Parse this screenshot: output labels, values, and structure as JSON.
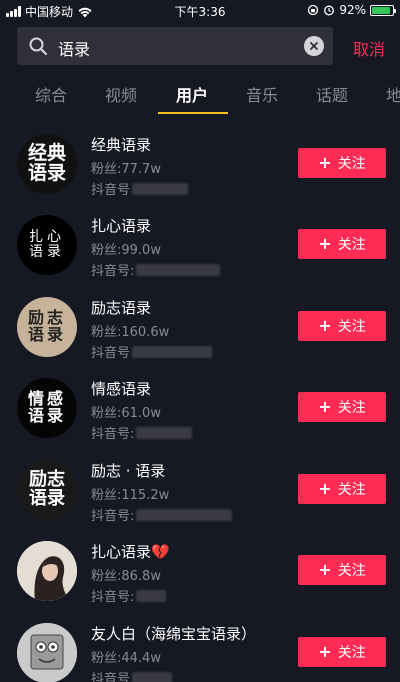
{
  "status_bar": {
    "carrier": "中国移动",
    "time": "下午3:36",
    "battery": "92%"
  },
  "search": {
    "query": "语录",
    "cancel_label": "取消"
  },
  "tabs": [
    {
      "label": "综合"
    },
    {
      "label": "视频"
    },
    {
      "label": "用户"
    },
    {
      "label": "音乐"
    },
    {
      "label": "话题"
    },
    {
      "label": "地"
    }
  ],
  "active_tab": "用户",
  "users": [
    {
      "name": "经典语录",
      "fans": "粉丝:77.7w",
      "douyin_id_label": "抖音号",
      "avatar_text": [
        "经典",
        "语录"
      ],
      "follow_label": "关注"
    },
    {
      "name": "扎心语录",
      "fans": "粉丝:99.0w",
      "douyin_id_label": "抖音号:",
      "avatar_text": [
        "扎心",
        "语录"
      ],
      "follow_label": "关注"
    },
    {
      "name": "励志语录",
      "fans": "粉丝:160.6w",
      "douyin_id_label": "抖音号",
      "avatar_text": [
        "励志",
        "语录"
      ],
      "follow_label": "关注"
    },
    {
      "name": "情感语录",
      "fans": "粉丝:61.0w",
      "douyin_id_label": "抖音号:",
      "avatar_text": [
        "情感",
        "语录"
      ],
      "follow_label": "关注"
    },
    {
      "name": "励志 · 语录",
      "fans": "粉丝:115.2w",
      "douyin_id_label": "抖音号:",
      "avatar_text": [
        "励志",
        "语录"
      ],
      "follow_label": "关注"
    },
    {
      "name": "扎心语录💔",
      "fans": "粉丝:86.8w",
      "douyin_id_label": "抖音号:",
      "avatar_text": [],
      "follow_label": "关注"
    },
    {
      "name": "友人白（海绵宝宝语录）",
      "fans": "粉丝:44.4w",
      "douyin_id_label": "抖音号",
      "avatar_text": [],
      "follow_label": "关注"
    }
  ],
  "colors": {
    "background": "#161823",
    "accent": "#fe2c55",
    "tab_indicator": "#f8c11d",
    "muted_text": "#8a8b91"
  }
}
